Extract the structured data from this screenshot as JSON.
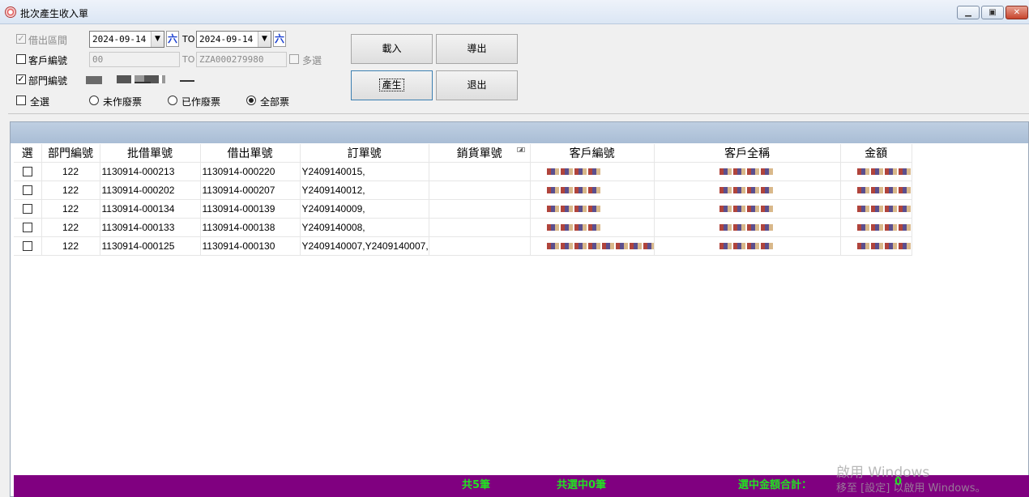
{
  "window": {
    "title": "批次產生收入單",
    "minimize_icon": "minimize-icon",
    "maximize_icon": "maximize-icon",
    "close_icon": "close-icon"
  },
  "filters": {
    "borrow_period_label": "借出區間",
    "date_from": "2024-09-14",
    "date_to": "2024-09-14",
    "to_label": "TO",
    "calendar_label": "六",
    "customer_no_label": "客戶編號",
    "customer_from": "00",
    "customer_to": "ZZA000279980",
    "multi_select_label": "多選",
    "department_label": "部門編號",
    "select_all_label": "全選",
    "radio_unvoided": "未作廢票",
    "radio_voided": "已作廢票",
    "radio_all": "全部票",
    "selected_radio": "全部票"
  },
  "buttons": {
    "load": "載入",
    "export": "導出",
    "generate": "產生",
    "exit": "退出"
  },
  "grid": {
    "columns": [
      "選",
      "部門編號",
      "批借單號",
      "借出單號",
      "訂單號",
      "銷貨單號",
      "客戶編號",
      "客戶全稱",
      "金額"
    ],
    "rows": [
      {
        "dept": "122",
        "batch": "1130914-000213",
        "borrow": "1130914-000220",
        "order": "Y2409140015,",
        "sales": ""
      },
      {
        "dept": "122",
        "batch": "1130914-000202",
        "borrow": "1130914-000207",
        "order": "Y2409140012,",
        "sales": ""
      },
      {
        "dept": "122",
        "batch": "1130914-000134",
        "borrow": "1130914-000139",
        "order": "Y2409140009,",
        "sales": ""
      },
      {
        "dept": "122",
        "batch": "1130914-000133",
        "borrow": "1130914-000138",
        "order": "Y2409140008,",
        "sales": ""
      },
      {
        "dept": "122",
        "batch": "1130914-000125",
        "borrow": "1130914-000130",
        "order": "Y2409140007,Y2409140007,",
        "sales": ""
      }
    ]
  },
  "status": {
    "total": "共5筆",
    "selected": "共選中0筆",
    "amount_label": "選中金額合計：",
    "amount_value": "0"
  },
  "watermark": {
    "line1": "啟用 Windows",
    "line2": "移至 [設定] 以啟用 Windows。"
  },
  "colors": {
    "status_bg": "#800080",
    "status_text": "#22e022",
    "calendar_text": "#1a3fd0"
  }
}
